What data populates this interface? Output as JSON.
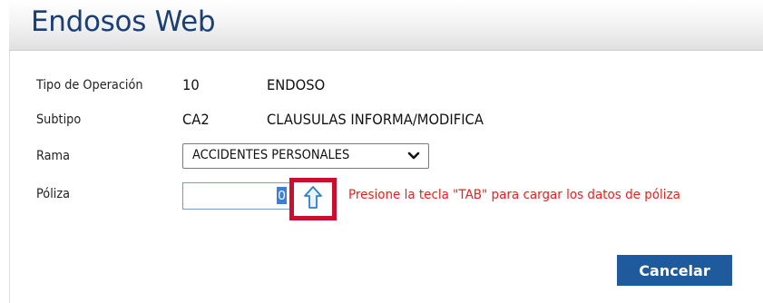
{
  "page": {
    "title": "Endosos Web"
  },
  "form": {
    "tipo_operacion": {
      "label": "Tipo de Operación",
      "code": "10",
      "description": "ENDOSO"
    },
    "subtipo": {
      "label": "Subtipo",
      "code": "CA2",
      "description": "CLAUSULAS INFORMA/MODIFICA"
    },
    "rama": {
      "label": "Rama",
      "selected": "ACCIDENTES PERSONALES"
    },
    "poliza": {
      "label": "Póliza",
      "value": "0",
      "hint": "Presione la tecla \"TAB\" para cargar los datos de póliza",
      "icon": "up-arrow-icon"
    }
  },
  "actions": {
    "cancel_label": "Cancelar"
  },
  "colors": {
    "title": "#1b3f73",
    "button_bg": "#1f5a9c",
    "hint": "#e8201e",
    "highlight_box": "#c8102e"
  }
}
